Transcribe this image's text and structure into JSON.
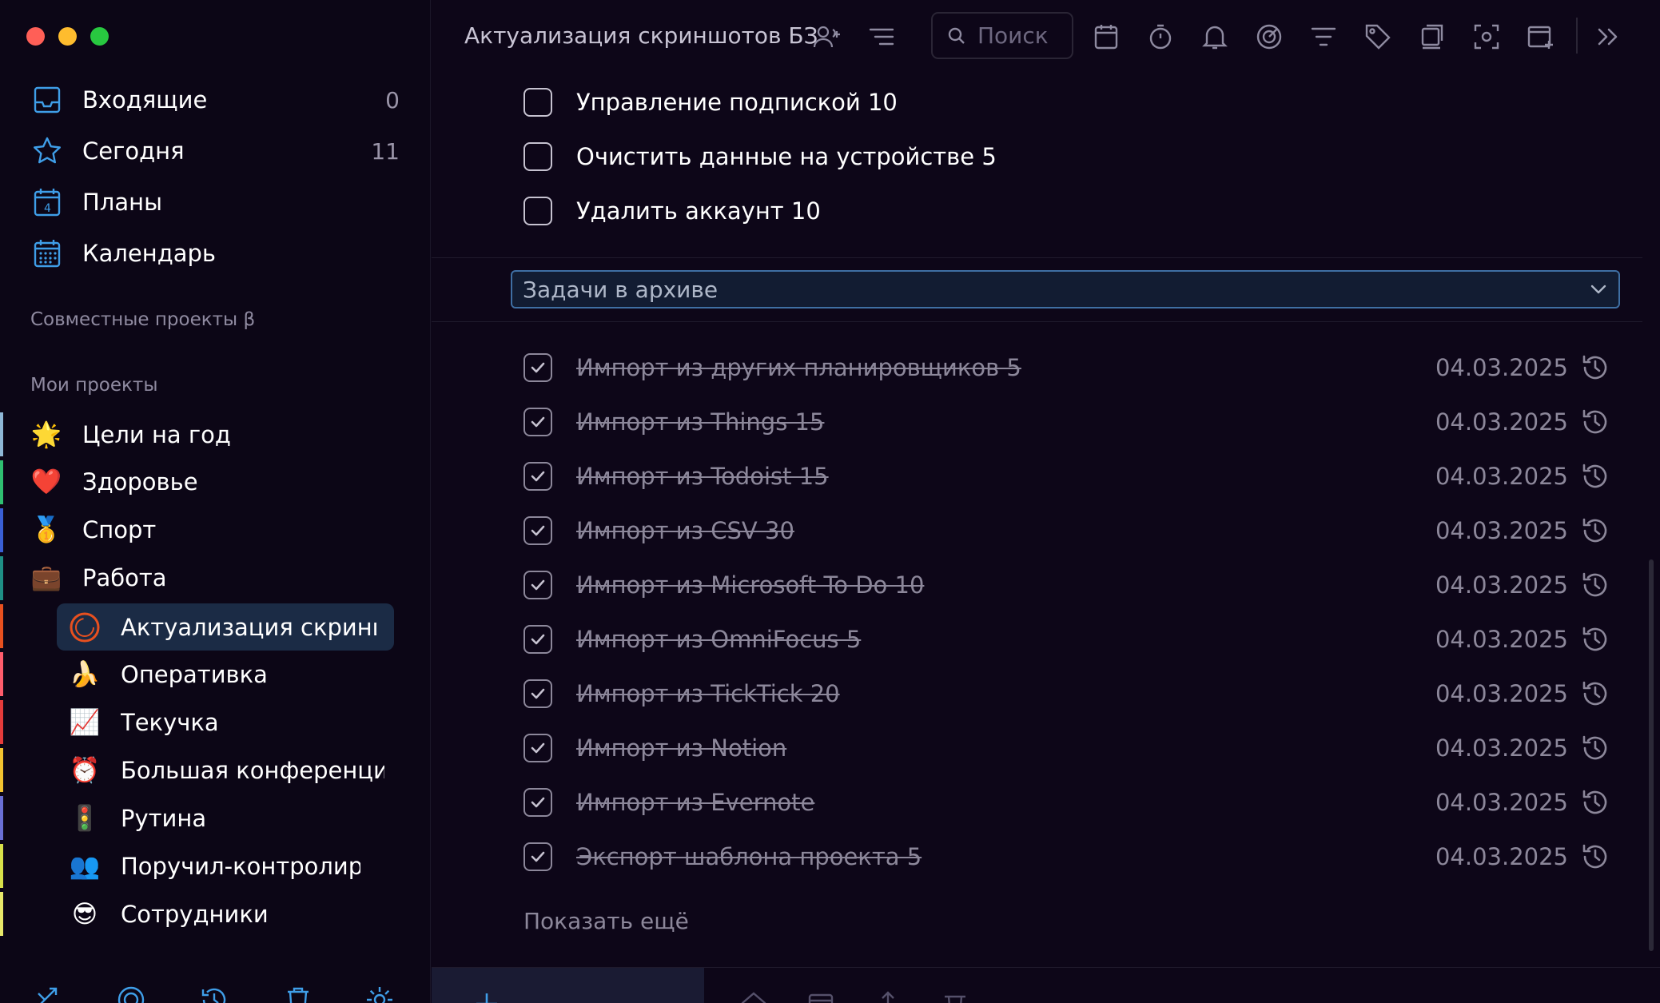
{
  "sidebar": {
    "nav": [
      {
        "label": "Входящие",
        "count": "0",
        "icon": "inbox-icon"
      },
      {
        "label": "Сегодня",
        "count": "11",
        "icon": "star-icon"
      },
      {
        "label": "Планы",
        "count": "",
        "icon": "calendar-4-icon"
      },
      {
        "label": "Календарь",
        "count": "",
        "icon": "calendar-grid-icon"
      }
    ],
    "shared_title": "Совместные проекты β",
    "my_title": "Мои проекты",
    "projects": [
      {
        "emoji": "🌟",
        "label": "Цели на год",
        "color": "#8fb7d6"
      },
      {
        "emoji": "❤️",
        "label": "Здоровье",
        "color": "#2fbf71"
      },
      {
        "emoji": "🥇",
        "label": "Спорт",
        "color": "#3a5fd6"
      },
      {
        "emoji": "💼",
        "label": "Работа",
        "color": "#1f8f86"
      }
    ],
    "subprojects": [
      {
        "emoji": "",
        "label": "Актуализация скриншотов БЗ",
        "color": "#e8501f",
        "active": true
      },
      {
        "emoji": "🍌",
        "label": "Оперативка",
        "color": "#ff5c6c"
      },
      {
        "emoji": "📈",
        "label": "Текучка",
        "color": "#e63b3b"
      },
      {
        "emoji": "⏰",
        "label": "Большая конференция по",
        "color": "#f2c230"
      },
      {
        "emoji": "🚦",
        "label": "Рутина",
        "color": "#6a6fd6"
      },
      {
        "emoji": "👥",
        "label": "Поручил-контролирую",
        "color": "#d8e04a"
      },
      {
        "emoji": "😎",
        "label": "Сотрудники",
        "color": "#e8e86a"
      }
    ]
  },
  "topbar": {
    "title": "Актуализация скриншотов БЗ",
    "search_placeholder": "Поиск"
  },
  "tasks": [
    {
      "label": "Управление подпиской 10"
    },
    {
      "label": "Очистить данные на устройстве 5"
    },
    {
      "label": "Удалить аккаунт 10"
    }
  ],
  "archive": {
    "dropdown_label": "Задачи в архиве",
    "items": [
      {
        "label": "Импорт из других планировщиков 5",
        "date": "04.03.2025"
      },
      {
        "label": "Импорт из Things 15",
        "date": "04.03.2025"
      },
      {
        "label": "Импорт из Todoist 15",
        "date": "04.03.2025"
      },
      {
        "label": "Импорт из CSV 30",
        "date": "04.03.2025"
      },
      {
        "label": "Импорт из Microsoft To Do 10",
        "date": "04.03.2025"
      },
      {
        "label": "Импорт из OmniFocus 5",
        "date": "04.03.2025"
      },
      {
        "label": "Импорт из TickTick 20",
        "date": "04.03.2025"
      },
      {
        "label": "Импорт из Notion",
        "date": "04.03.2025"
      },
      {
        "label": "Импорт из Evernote",
        "date": "04.03.2025"
      },
      {
        "label": "Экспорт шаблона проекта 5",
        "date": "04.03.2025"
      }
    ],
    "show_more": "Показать ещё"
  },
  "colors": {
    "accent": "#3f6fa3",
    "active_bg": "#1b2b45",
    "icon_blue": "#3f9ee8"
  }
}
